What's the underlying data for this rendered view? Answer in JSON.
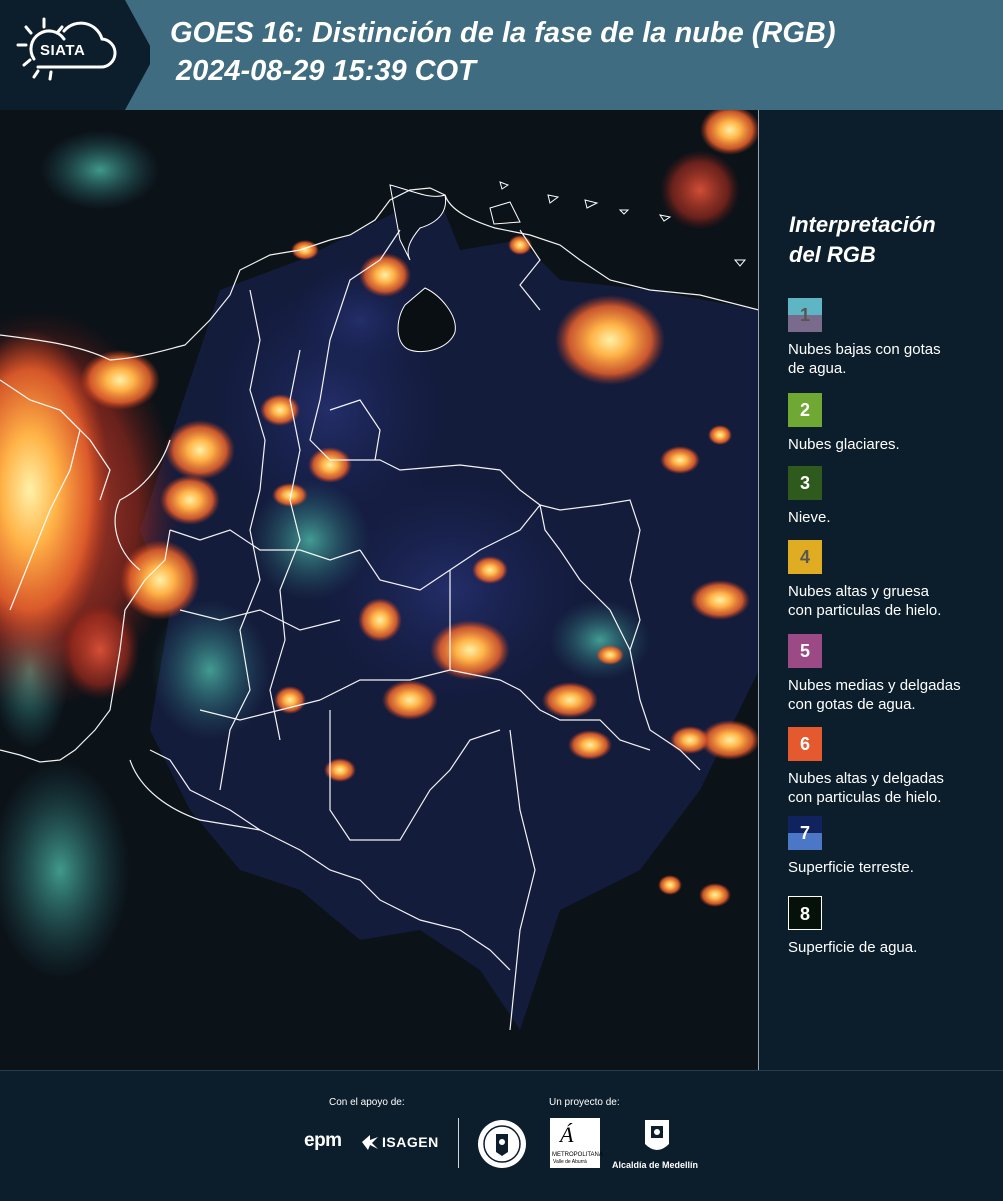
{
  "header": {
    "logo_text": "SIATA",
    "title_line1": "GOES 16: Distinción de la fase de la nube (RGB)",
    "title_line2": "2024-08-29 15:39 COT"
  },
  "legend": {
    "title_line1": "Interpretación",
    "title_line2": "del RGB",
    "items": [
      {
        "num": "1",
        "label_1": "Nubes bajas con gotas",
        "label_2": "de agua.",
        "color_top": "#5eb6c4",
        "color_bottom": "#7a6a8c",
        "num_color": "#555555"
      },
      {
        "num": "2",
        "label_1": "Nubes glaciares.",
        "label_2": "",
        "color_top": "#6fa832",
        "color_bottom": "#6fa832",
        "num_color": "#ffffff"
      },
      {
        "num": "3",
        "label_1": "Nieve.",
        "label_2": "",
        "color_top": "#2f5a1e",
        "color_bottom": "#2f5a1e",
        "num_color": "#ffffff"
      },
      {
        "num": "4",
        "label_1": "Nubes altas y gruesa",
        "label_2": "con particulas de hielo.",
        "color_top": "#e0ad22",
        "color_bottom": "#e0ad22",
        "num_color": "#555555"
      },
      {
        "num": "5",
        "label_1": "Nubes medias y delgadas",
        "label_2": "con gotas de agua.",
        "color_top": "#9b4a86",
        "color_bottom": "#9b4a86",
        "num_color": "#ffffff"
      },
      {
        "num": "6",
        "label_1": "Nubes altas y delgadas",
        "label_2": "con particulas de hielo.",
        "color_top": "#e45a2e",
        "color_bottom": "#e45a2e",
        "num_color": "#ffffff"
      },
      {
        "num": "7",
        "label_1": "Superficie terreste.",
        "label_2": "",
        "color_top": "#10235e",
        "color_bottom": "#4b77c6",
        "num_color": "#ffffff"
      },
      {
        "num": "8",
        "label_1": "Superficie de agua.",
        "label_2": "",
        "color_top": "#061209",
        "color_bottom": "#061209",
        "num_color": "#ffffff"
      }
    ]
  },
  "footer": {
    "support_label": "Con el apoyo de:",
    "project_label": "Un proyecto de:",
    "epm": "epm",
    "isagen": "ISAGEN",
    "area_text_1": "METROPOLITANA",
    "area_text_2": "Valle de Aburrá",
    "alcaldia": "Alcaldía de Medellín"
  }
}
